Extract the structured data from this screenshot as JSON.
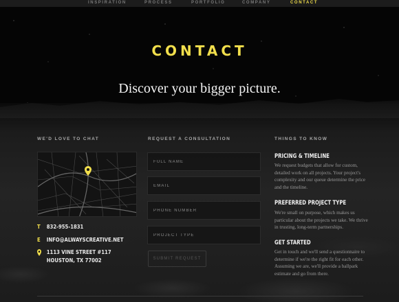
{
  "nav": {
    "items": [
      {
        "label": "INSPIRATION"
      },
      {
        "label": "PROCESS"
      },
      {
        "label": "PORTFOLIO"
      },
      {
        "label": "COMPANY"
      },
      {
        "label": "CONTACT",
        "active": true
      }
    ]
  },
  "hero": {
    "title": "CONTACT",
    "subtitle": "Discover your bigger picture."
  },
  "chat": {
    "heading": "WE'D LOVE TO CHAT",
    "phone_icon": "T",
    "phone": "832-955-1831",
    "email_icon": "E",
    "email": "INFO@ALWAYSCREATIVE.NET",
    "address_line1": "1113 VINE STREET #117",
    "address_line2": "HOUSTON, TX 77002"
  },
  "form": {
    "heading": "REQUEST A CONSULTATION",
    "full_name_placeholder": "FULL NAME",
    "email_placeholder": "EMAIL",
    "phone_placeholder": "PHONE NUMBER",
    "project_type_placeholder": "PROJECT TYPE",
    "submit_label": "SUBMIT REQUEST"
  },
  "things": {
    "heading": "THINGS TO KNOW",
    "items": [
      {
        "title": "PRICING & TIMELINE",
        "body": "We request budgets that allow for custom, detailed work on all projects. Your project's complexity and our queue determine the price and the timeline."
      },
      {
        "title": "PREFERRED PROJECT TYPE",
        "body": "We're small on purpose, which makes us particular about the projects we take. We thrive in trusting, long-term partnerships."
      },
      {
        "title": "GET STARTED",
        "body": "Get in touch and we'll send a questionnaire to determine if we're the right fit for each other. Assuming we are, we'll provide a ballpark estimate and go from there."
      }
    ]
  },
  "colors": {
    "accent": "#f2df4c",
    "background": "#0b0b0b"
  },
  "icons": {
    "map_pin": "map-pin-icon"
  }
}
